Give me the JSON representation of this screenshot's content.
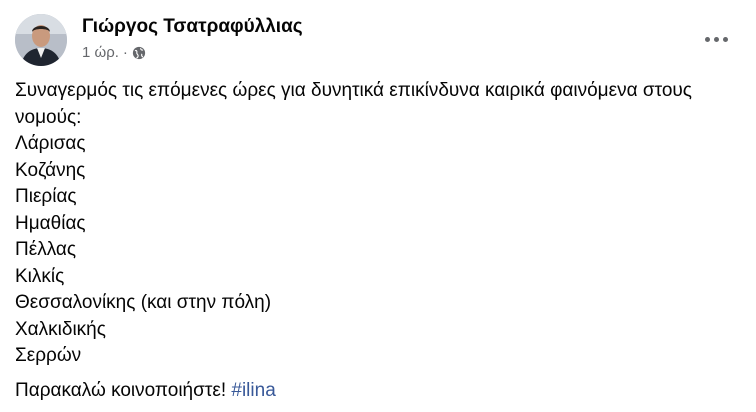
{
  "post": {
    "author": "Γιώργος Τσατραφύλλιας",
    "time": "1 ώρ.",
    "separator": "·",
    "privacy_icon": "globe-icon",
    "more_icon": "more-horizontal-icon",
    "text_intro_line1": "Συναγερμός τις επόμενες ώρες για δυνητικά επικίνδυνα καιρικά φαινόμενα στους",
    "text_intro_line2": "νομούς:",
    "regions": [
      "Λάρισας",
      "Κοζάνης",
      "Πιερίας",
      "Ημαθίας",
      "Πέλλας",
      "Κιλκίς",
      "Θεσσαλονίκης (και στην πόλη)",
      "Χαλκιδικής",
      "Σερρών"
    ],
    "cta_text": "Παρακαλώ κοινοποιήστε! ",
    "hashtag": "#ilina",
    "colors": {
      "text": "#050505",
      "secondary": "#65676b",
      "link": "#385898"
    }
  }
}
